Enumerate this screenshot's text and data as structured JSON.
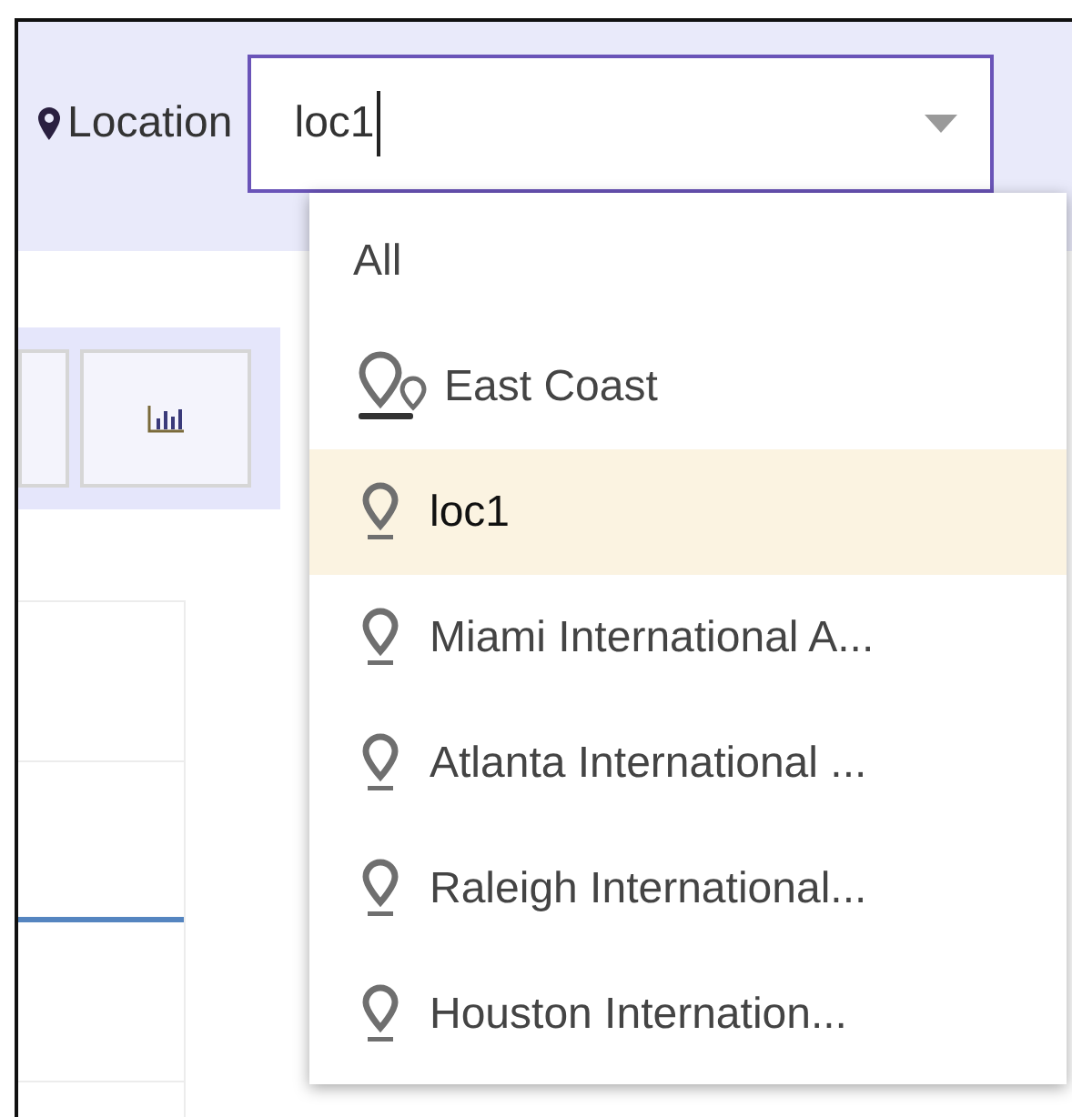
{
  "filter": {
    "label": "Location",
    "value": "loc1"
  },
  "dropdown": {
    "options": [
      {
        "label": "All",
        "kind": "all",
        "selected": false
      },
      {
        "label": "East Coast",
        "kind": "group",
        "selected": false
      },
      {
        "label": "loc1",
        "kind": "location",
        "selected": true
      },
      {
        "label": "Miami International A...",
        "kind": "location",
        "selected": false
      },
      {
        "label": "Atlanta International ...",
        "kind": "location",
        "selected": false
      },
      {
        "label": "Raleigh International...",
        "kind": "location",
        "selected": false
      },
      {
        "label": "Houston Internation...",
        "kind": "location",
        "selected": false
      }
    ]
  }
}
